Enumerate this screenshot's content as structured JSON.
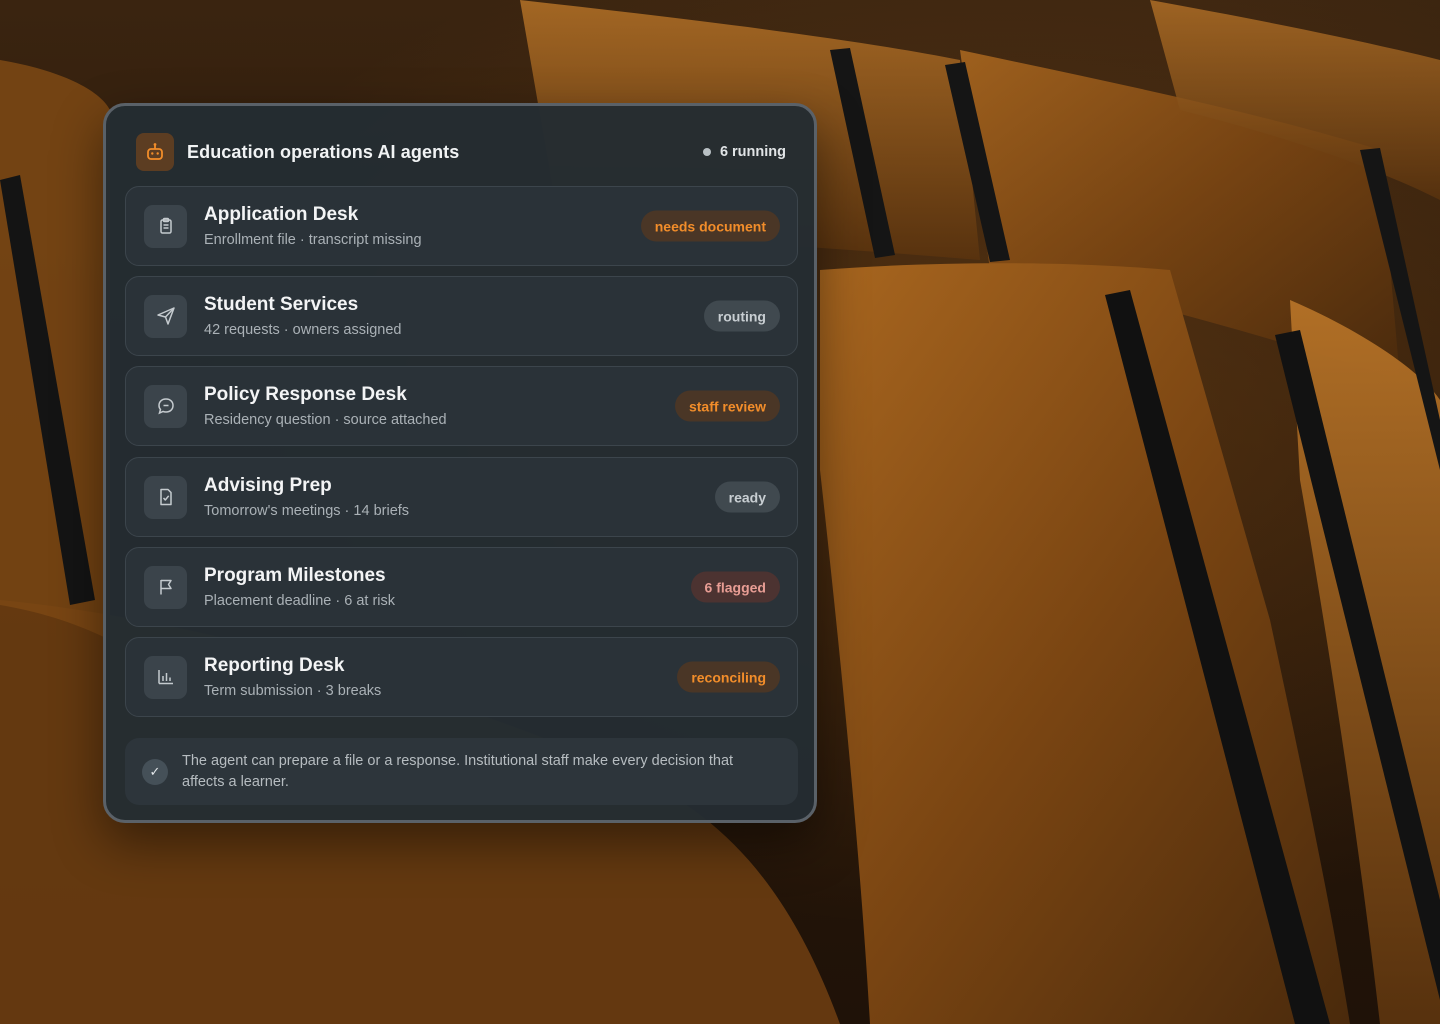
{
  "header": {
    "title": "Education operations AI agents",
    "status": "6 running",
    "app_icon": "robot-icon"
  },
  "agents": [
    {
      "name": "Application Desk",
      "detail": "Enrollment file · transcript missing",
      "status": "needs document",
      "icon": "clipboard-icon",
      "status_color": "#f28d2a"
    },
    {
      "name": "Student Services",
      "detail": "42 requests · owners assigned",
      "status": "routing",
      "icon": "send-icon",
      "status_color": "#c8ced2"
    },
    {
      "name": "Policy Response Desk",
      "detail": "Residency question · source attached",
      "status": "staff review",
      "icon": "chat-icon",
      "status_color": "#f28d2a"
    },
    {
      "name": "Advising Prep",
      "detail": "Tomorrow's meetings · 14 briefs",
      "status": "ready",
      "icon": "document-check-icon",
      "status_color": "#c8ced2"
    },
    {
      "name": "Program Milestones",
      "detail": "Placement deadline · 6 at risk",
      "status": "6 flagged",
      "icon": "flag-icon",
      "status_color": "#e89d94"
    },
    {
      "name": "Reporting Desk",
      "detail": "Term submission · 3 breaks",
      "status": "reconciling",
      "icon": "bar-chart-icon",
      "status_color": "#f28d2a"
    }
  ],
  "footer": {
    "text": "The agent can prepare a file or a response. Institutional staff make every decision that affects a learner.",
    "icon": "check-icon"
  },
  "colors": {
    "accent": "#f28d2a",
    "panel": "#242c32"
  }
}
